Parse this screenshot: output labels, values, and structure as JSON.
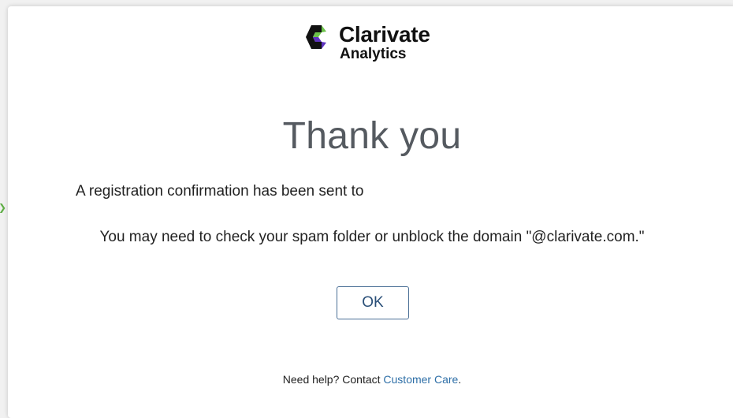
{
  "logo": {
    "name": "Clarivate",
    "sub": "Analytics",
    "mark_colors": {
      "green": "#6cc24a",
      "purple": "#5e33bf",
      "dark": "#111111"
    }
  },
  "dialog": {
    "title": "Thank you",
    "message_confirm": "A registration confirmation has been sent to",
    "message_spam": "You may need to check your spam folder or unblock the domain \"@clarivate.com.\"",
    "ok_label": "OK"
  },
  "help": {
    "prefix": "Need help? Contact ",
    "link_label": "Customer Care",
    "suffix": "."
  },
  "colors": {
    "title": "#555a60",
    "link": "#2e6fa7",
    "button_border": "#4a6f96",
    "edge_chevron": "#5fae46"
  },
  "icons": {
    "edge": "chevron-right-icon",
    "logo": "clarivate-logo-icon"
  }
}
